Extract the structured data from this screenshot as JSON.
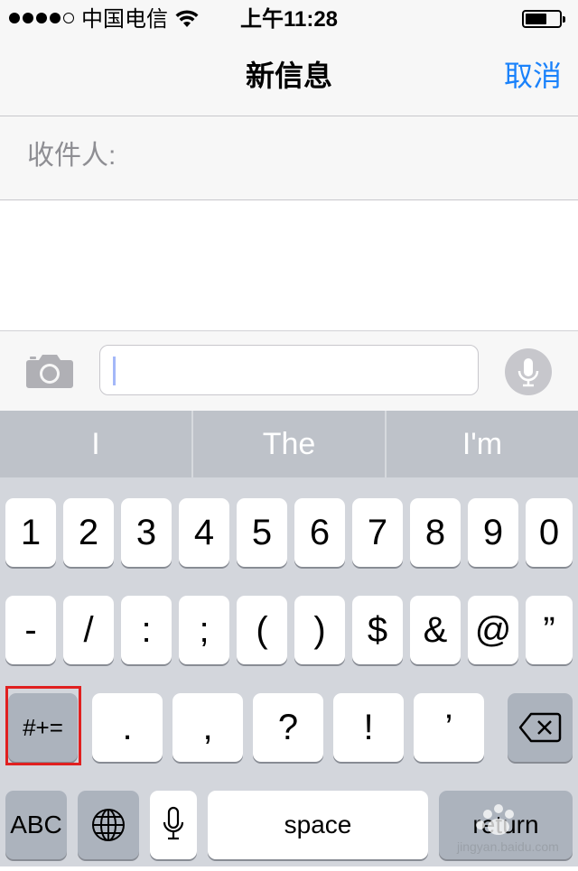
{
  "status_bar": {
    "signal_bars": 5,
    "signal_filled": 4,
    "carrier": "中国电信",
    "time": "上午11:28",
    "battery_level": 0.65
  },
  "nav": {
    "title": "新信息",
    "cancel_label": "取消"
  },
  "recipient": {
    "label": "收件人:"
  },
  "compose": {
    "input_value": ""
  },
  "suggestions": [
    "I",
    "The",
    "I'm"
  ],
  "keyboard": {
    "row1": [
      "1",
      "2",
      "3",
      "4",
      "5",
      "6",
      "7",
      "8",
      "9",
      "0"
    ],
    "row2": [
      "-",
      "/",
      ":",
      ";",
      "(",
      ")",
      "$",
      "&",
      "@",
      "”"
    ],
    "row3": {
      "mode_key": "#+=",
      "keys": [
        ".",
        ",",
        "?",
        "!",
        "’"
      ]
    },
    "row4": {
      "abc": "ABC",
      "space": "space",
      "return": "return"
    }
  },
  "watermark": {
    "site": "jingyan.baidu.com"
  },
  "colors": {
    "accent": "#1a82fb",
    "highlight": "#e02020"
  },
  "icons": [
    "wifi-icon",
    "battery-icon",
    "camera-icon",
    "microphone-icon",
    "globe-icon",
    "backspace-icon"
  ]
}
